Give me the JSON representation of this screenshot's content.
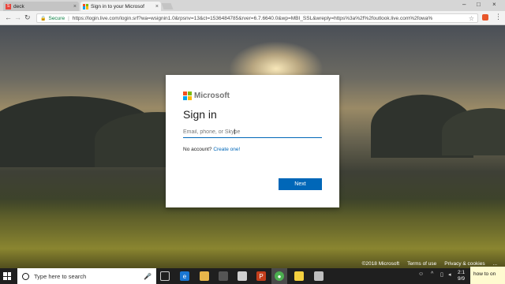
{
  "browser": {
    "tabs": [
      {
        "label": "deck",
        "favicon": "slides-icon",
        "active": false
      },
      {
        "label": "Sign in to your Microsof",
        "favicon": "microsoft-icon",
        "active": true
      }
    ],
    "secure_label": "Secure",
    "url": "https://login.live.com/login.srf?wa=wsignin1.0&rpsnv=13&ct=1536484785&rver=6.7.6640.0&wp=MBI_SSL&wreply=https%3a%2f%2foutlook.live.com%2fowa%"
  },
  "signin": {
    "brand": "Microsoft",
    "title": "Sign in",
    "email_placeholder": "Email, phone, or Skype",
    "no_account": "No account?",
    "create_link": "Create one!",
    "next_label": "Next",
    "colors": {
      "accent": "#0067b8",
      "red": "#f25022",
      "green": "#7fba00",
      "blue": "#00a4ef",
      "yellow": "#ffb900"
    }
  },
  "footer": {
    "copyright": "©2018 Microsoft",
    "terms": "Terms of use",
    "privacy": "Privacy & cookies",
    "more": "..."
  },
  "taskbar": {
    "search_placeholder": "Type here to search",
    "clock_time": "2:1",
    "clock_date": "9/9",
    "notification": "how to on"
  }
}
